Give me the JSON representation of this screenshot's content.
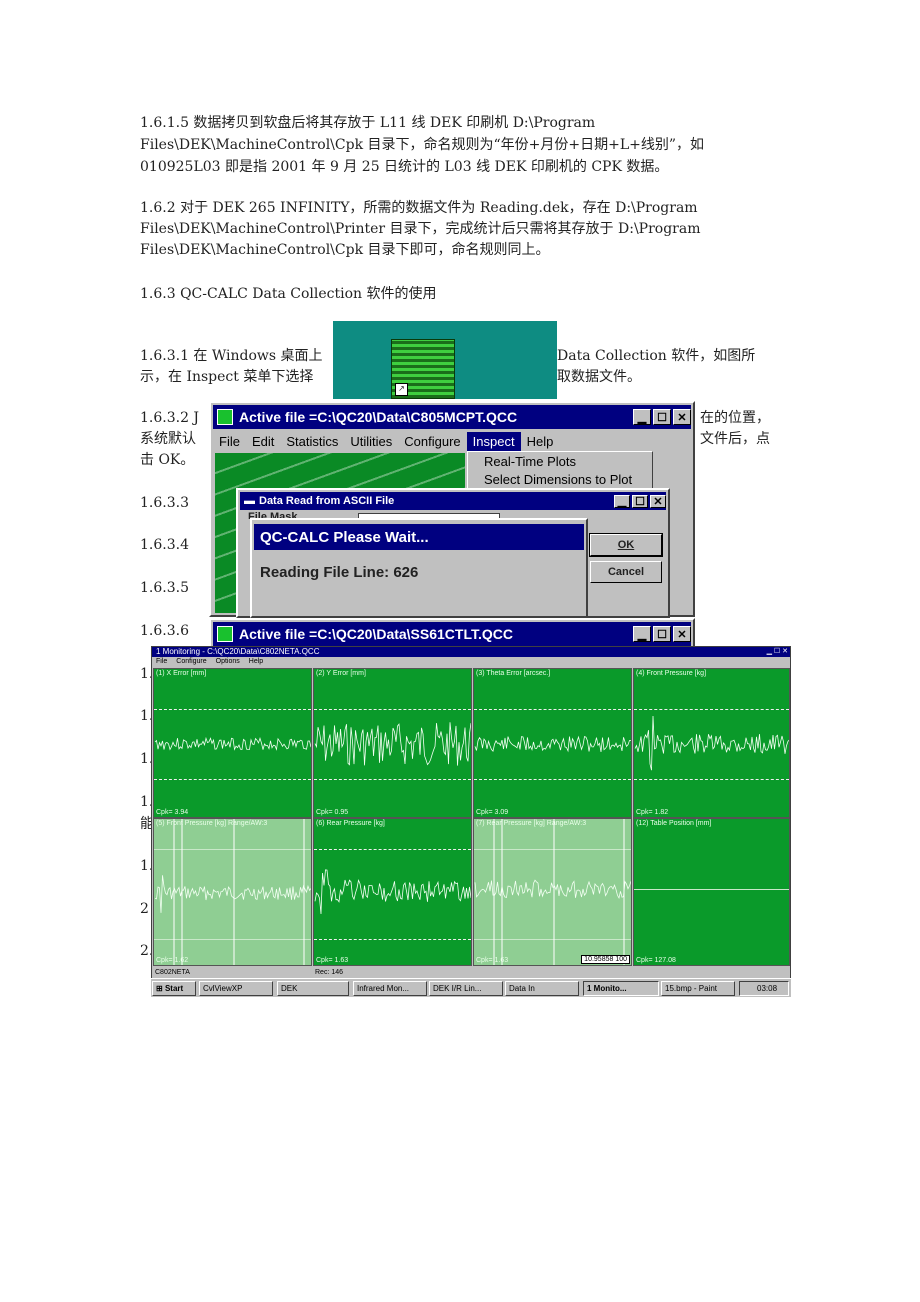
{
  "doc": {
    "p1_l1": "1.6.1.5 数据拷贝到软盘后将其存放于 L11 线 DEK 印刷机 D:\\Program",
    "p1_l2": "Files\\DEK\\MachineControl\\Cpk 目录下，命名规则为“年份+月份+日期+L+线别”，如",
    "p1_l3": "010925L03 即是指 2001 年 9 月 25 日统计的 L03 线 DEK 印刷机的 CPK 数据。",
    "p2_l1": "1.6.2 对于 DEK 265 INFINITY，所需的数据文件为 Reading.dek，存在 D:\\Program",
    "p2_l2": "Files\\DEK\\MachineControl\\Printer 目录下，完成统计后只需将其存放于 D:\\Program",
    "p2_l3": "Files\\DEK\\MachineControl\\Cpk 目录下即可，命名规则同上。",
    "p3": "1.6.3 QC-CALC Data Collection 软件的使用",
    "p4_l1a": "1.6.3.1 在 Windows 桌面上",
    "p4_l1b": "Data Collection 软件，如图所",
    "p4_l2a": "示，在 Inspect 菜单下选择",
    "p4_l2b": "取数据文件。",
    "p5_l1a": "1.6.3.2 J",
    "p5_l1b": "在的位置，",
    "p5_l2a": "系统默认",
    "p5_l2b": "文件后，点",
    "p5_l3": "击 OK。",
    "p6": "1.6.3.3",
    "p7": "1.6.3.4",
    "p8": "1.6.3.5",
    "p9": "1.6.3.6",
    "side": [
      "1.",
      "1.",
      "1.",
      "1.",
      "能",
      "1.",
      "2",
      "2."
    ]
  },
  "qcc_window": {
    "title": "Active file =C:\\QC20\\Data\\C805MCPT.QCC",
    "menus": [
      "File",
      "Edit",
      "Statistics",
      "Utilities",
      "Configure",
      "Inspect",
      "Help"
    ],
    "active_menu": "Inspect",
    "dropdown": [
      "Real-Time Plots",
      "Select Dimensions to Plot"
    ]
  },
  "ascii_dialog": {
    "title": "Data Read from ASCII File",
    "field_label": "File Mask",
    "ok": "OK",
    "cancel": "Cancel"
  },
  "wait_dialog": {
    "title": "QC-CALC Please Wait...",
    "message": "Reading File Line: 626"
  },
  "qcc_window2": {
    "title": "Active file =C:\\QC20\\Data\\SS61CTLT.QCC"
  },
  "monitor": {
    "title": "1 Monitoring - C:\\QC20\\Data\\C802NETA.QCC",
    "menus": [
      "File",
      "Configure",
      "Options",
      "Help"
    ],
    "panels": [
      {
        "title": "(1) X Error [mm]",
        "cpk": "Cpk= 3.94"
      },
      {
        "title": "(2) Y Error [mm]",
        "cpk": "Cpk= 0.95"
      },
      {
        "title": "(3) Theta Error [arcsec.]",
        "cpk": "Cpk= 3.09"
      },
      {
        "title": "(4) Front Pressure [kg]",
        "cpk": "Cpk= 1.82"
      },
      {
        "title": "(5) Front Pressure [kg] Range/AW:3",
        "cpk": "Cpk= 1.62"
      },
      {
        "title": "(6) Rear Pressure [kg]",
        "cpk": "Cpk= 1.63"
      },
      {
        "title": "(7) Rear Pressure [kg] Range/AW:3",
        "cpk": "Cpk= 1.63"
      },
      {
        "title": "(12) Table Position [mm]",
        "cpk": "Cpk= 127.08"
      }
    ],
    "value_box": "10.95858  100",
    "status_left": "C802NETA",
    "status_rec": "Rec: 146"
  },
  "taskbar": {
    "start": "Start",
    "items": [
      "CvlViewXP",
      "DEK",
      "Infrared Mon...",
      "DEK I/R Lin...",
      "Data In",
      "1 Monito...",
      "15.bmp - Paint"
    ],
    "clock": "03:08"
  }
}
